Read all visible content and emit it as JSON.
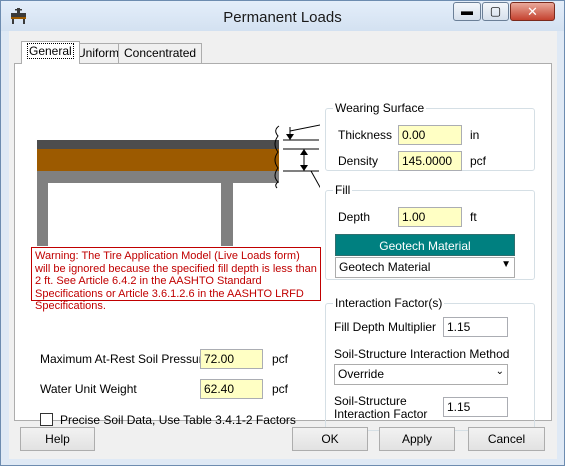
{
  "window": {
    "title": "Permanent Loads"
  },
  "tabs": [
    "General",
    "Uniform",
    "Concentrated"
  ],
  "wearing_surface": {
    "legend": "Wearing Surface",
    "thickness_label": "Thickness",
    "thickness_value": "0.00",
    "thickness_unit": "in",
    "density_label": "Density",
    "density_value": "145.0000",
    "density_unit": "pcf"
  },
  "fill": {
    "legend": "Fill",
    "depth_label": "Depth",
    "depth_value": "1.00",
    "depth_unit": "ft",
    "geotech_header": "Geotech Material",
    "geotech_value": "Geotech Material"
  },
  "warning": {
    "text": "Warning: The Tire Application Model (Live Loads form) will be ignored because the specified fill depth is less than 2 ft. See Article 6.4.2 in the AASHTO Standard Specifications or Article 3.6.1.2.6 in the AASHTO LRFD Specifications."
  },
  "soil": {
    "pressure_label": "Maximum At-Rest Soil Pressure",
    "pressure_value": "72.00",
    "pressure_unit": "pcf",
    "water_label": "Water Unit Weight",
    "water_value": "62.40",
    "water_unit": "pcf",
    "precise_label": "Precise Soil Data, Use Table 3.4.1-2 Factors",
    "precise_checked": false
  },
  "interaction": {
    "legend": "Interaction Factor(s)",
    "fill_depth_multiplier_label": "Fill Depth Multiplier",
    "fill_depth_multiplier_value": "1.15",
    "method_label": "Soil-Structure Interaction Method",
    "method_value": "Override",
    "ssi_factor_label_1": "Soil-Structure",
    "ssi_factor_label_2": "Interaction Factor",
    "ssi_factor_value": "1.15"
  },
  "buttons": {
    "help": "Help",
    "ok": "OK",
    "apply": "Apply",
    "cancel": "Cancel"
  },
  "colors": {
    "fill_layer": "#9c5a00",
    "wearing_layer": "#4d4d4d",
    "culvert": "#808080",
    "geotech_header": "#008080",
    "warning": "#c00000",
    "input_bg": "#ffffc4"
  }
}
